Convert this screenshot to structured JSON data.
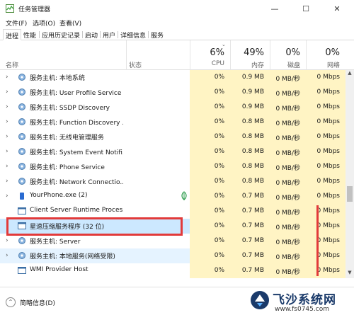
{
  "window": {
    "title": "任务管理器"
  },
  "menu": [
    "文件(F)",
    "选项(O)",
    "查看(V)"
  ],
  "tabs": [
    "进程",
    "性能",
    "应用历史记录",
    "启动",
    "用户",
    "详细信息",
    "服务"
  ],
  "header": {
    "name": "名称",
    "status": "状态",
    "cpu_pct": "6%",
    "cpu": "CPU",
    "mem_pct": "49%",
    "mem": "内存",
    "disk_pct": "0%",
    "disk": "磁盘",
    "net_pct": "0%",
    "net": "网络"
  },
  "rows": [
    {
      "name": "服务主机: 本地系统",
      "cpu": "0%",
      "mem": "0.9 MB",
      "disk": "0 MB/秒",
      "net": "0 Mbps"
    },
    {
      "name": "服务主机: User Profile Service",
      "cpu": "0%",
      "mem": "0.9 MB",
      "disk": "0 MB/秒",
      "net": "0 Mbps"
    },
    {
      "name": "服务主机: SSDP Discovery",
      "cpu": "0%",
      "mem": "0.9 MB",
      "disk": "0 MB/秒",
      "net": "0 Mbps"
    },
    {
      "name": "服务主机: Function Discovery ...",
      "cpu": "0%",
      "mem": "0.8 MB",
      "disk": "0 MB/秒",
      "net": "0 Mbps"
    },
    {
      "name": "服务主机: 无线电管理服务",
      "cpu": "0%",
      "mem": "0.8 MB",
      "disk": "0 MB/秒",
      "net": "0 Mbps"
    },
    {
      "name": "服务主机: System Event Notifi...",
      "cpu": "0%",
      "mem": "0.8 MB",
      "disk": "0 MB/秒",
      "net": "0 Mbps"
    },
    {
      "name": "服务主机: Phone Service",
      "cpu": "0%",
      "mem": "0.8 MB",
      "disk": "0 MB/秒",
      "net": "0 Mbps"
    },
    {
      "name": "服务主机: Network Connectio...",
      "cpu": "0%",
      "mem": "0.8 MB",
      "disk": "0 MB/秒",
      "net": "0 Mbps"
    },
    {
      "name": "YourPhone.exe (2)",
      "cpu": "0%",
      "mem": "0.7 MB",
      "disk": "0 MB/秒",
      "net": "0 Mbps"
    },
    {
      "name": "Client Server Runtime Process",
      "cpu": "0%",
      "mem": "0.7 MB",
      "disk": "0 MB/秒",
      "net": "0 Mbps"
    },
    {
      "name": "星速压缩服务程序 (32 位)",
      "cpu": "0%",
      "mem": "0.7 MB",
      "disk": "0 MB/秒",
      "net": "0 Mbps"
    },
    {
      "name": "服务主机: Server",
      "cpu": "0%",
      "mem": "0.7 MB",
      "disk": "0 MB/秒",
      "net": "0 Mbps"
    },
    {
      "name": "服务主机: 本地服务(网络受限)",
      "cpu": "0%",
      "mem": "0.7 MB",
      "disk": "0 MB/秒",
      "net": "0 Mbps"
    },
    {
      "name": "WMI Provider Host",
      "cpu": "0%",
      "mem": "0.7 MB",
      "disk": "0 MB/秒",
      "net": "0 Mbps"
    }
  ],
  "footer": {
    "label": "简略信息(D)"
  },
  "watermark": {
    "text": "飞沙系统网",
    "url": "www.fs0745.com"
  },
  "colors": {
    "accent": "#cce8ff",
    "heat": "#fff4c4",
    "highlight": "#e23a3a"
  }
}
